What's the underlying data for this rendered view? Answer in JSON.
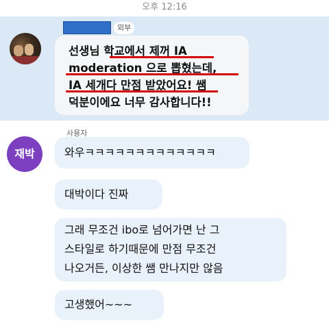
{
  "status_time": "오후 12:16",
  "received": {
    "tag": "외부",
    "lines": [
      "선생님 학교에서 제꺼 IA",
      "moderation 으로 뽑혔는데,",
      "IA 세개다 만점 받았어요! 쌤",
      "덕분이에요 너무 감사합니다!!"
    ]
  },
  "sender": {
    "label": "사용자",
    "avatar_text": "재박",
    "avatar_color": "#7b3fbf"
  },
  "messages": [
    {
      "lines": [
        "와우ㅋㅋㅋㅋㅋㅋㅋㅋㅋㅋㅋㅋㅋ"
      ]
    },
    {
      "lines": [
        "대박이다 진짜"
      ]
    },
    {
      "lines": [
        "그래 무조건 ibo로 넘어가면 난 그",
        "스타일로 하기때문에 만점 무조건",
        "나오거든, 이상한 쌤 만나지만 않음"
      ]
    },
    {
      "lines": [
        "고생했어~~~"
      ]
    }
  ],
  "colors": {
    "received_band": "#dbe9f7",
    "underline": "#d40000",
    "redaction": "#2f6fc7"
  }
}
